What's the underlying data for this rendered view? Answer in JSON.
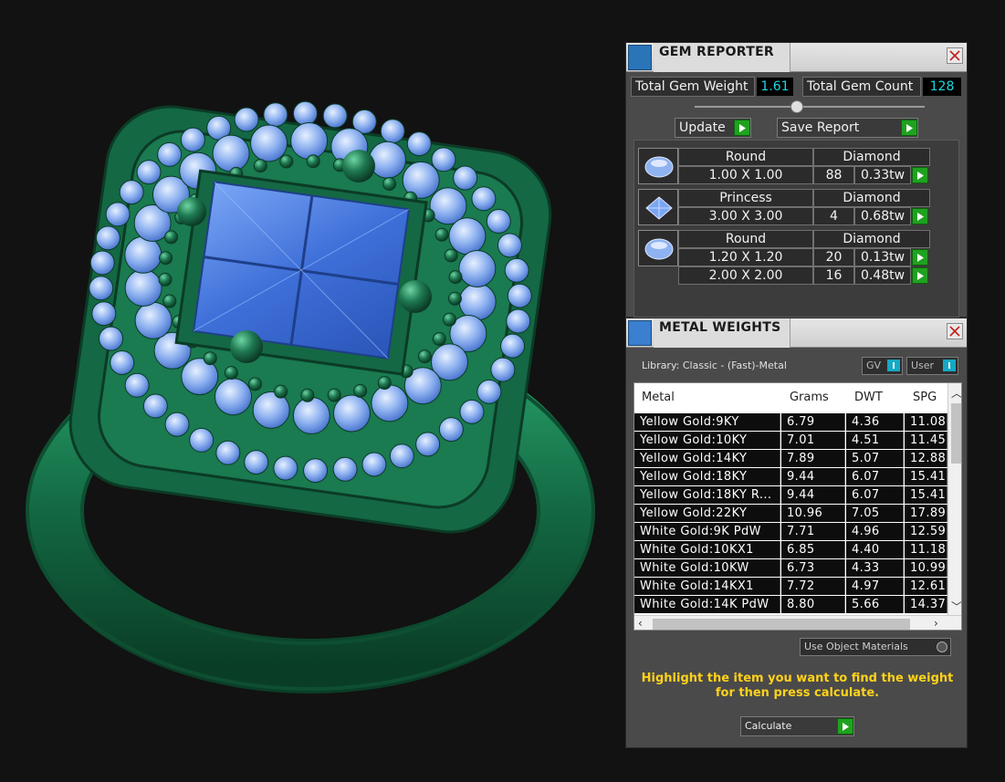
{
  "colors": {
    "ring_metal": "#1f7a52",
    "gem_blue": "#5a8be8",
    "accent_cyan": "#1bd6e0",
    "button_green": "#1fa21f",
    "hint_yellow": "#ffd21a"
  },
  "gem_reporter": {
    "title": "GEM REPORTER",
    "total_weight_label": "Total Gem Weight",
    "total_weight_value": "1.61",
    "total_count_label": "Total Gem Count",
    "total_count_value": "128",
    "update_label": "Update",
    "save_report_label": "Save Report",
    "groups": [
      {
        "shape": "Round",
        "material": "Diamond",
        "icon": "round-gem-icon",
        "rows": [
          {
            "size": "1.00 X 1.00",
            "count": "88",
            "weight": "0.33tw"
          }
        ]
      },
      {
        "shape": "Princess",
        "material": "Diamond",
        "icon": "princess-gem-icon",
        "rows": [
          {
            "size": "3.00 X 3.00",
            "count": "4",
            "weight": "0.68tw"
          }
        ]
      },
      {
        "shape": "Round",
        "material": "Diamond",
        "icon": "round-gem-icon",
        "rows": [
          {
            "size": "1.20 X 1.20",
            "count": "20",
            "weight": "0.13tw"
          },
          {
            "size": "2.00 X 2.00",
            "count": "16",
            "weight": "0.48tw"
          }
        ]
      }
    ]
  },
  "metal_weights": {
    "title": "METAL WEIGHTS",
    "library": "Library: Classic - (Fast)-Metal",
    "toggle_gv": "GV",
    "toggle_user": "User",
    "columns": [
      "Metal",
      "Grams",
      "DWT",
      "SPG"
    ],
    "rows": [
      {
        "metal": "Yellow Gold:9KY",
        "grams": "6.79",
        "dwt": "4.36",
        "spg": "11.08"
      },
      {
        "metal": "Yellow Gold:10KY",
        "grams": "7.01",
        "dwt": "4.51",
        "spg": "11.45"
      },
      {
        "metal": "Yellow Gold:14KY",
        "grams": "7.89",
        "dwt": "5.07",
        "spg": "12.88"
      },
      {
        "metal": "Yellow Gold:18KY",
        "grams": "9.44",
        "dwt": "6.07",
        "spg": "15.41"
      },
      {
        "metal": "Yellow Gold:18KY R...",
        "grams": "9.44",
        "dwt": "6.07",
        "spg": "15.41"
      },
      {
        "metal": "Yellow Gold:22KY",
        "grams": "10.96",
        "dwt": "7.05",
        "spg": "17.89"
      },
      {
        "metal": "White Gold:9K PdW",
        "grams": "7.71",
        "dwt": "4.96",
        "spg": "12.59"
      },
      {
        "metal": "White Gold:10KX1",
        "grams": "6.85",
        "dwt": "4.40",
        "spg": "11.18"
      },
      {
        "metal": "White Gold:10KW",
        "grams": "6.73",
        "dwt": "4.33",
        "spg": "10.99"
      },
      {
        "metal": "White Gold:14KX1",
        "grams": "7.72",
        "dwt": "4.97",
        "spg": "12.61"
      },
      {
        "metal": "White Gold:14K PdW",
        "grams": "8.80",
        "dwt": "5.66",
        "spg": "14.37"
      }
    ],
    "use_object_materials": "Use Object Materials",
    "hint_line1": "Highlight the item you want to find the weight",
    "hint_line2": "for then press calculate.",
    "calculate_label": "Calculate"
  }
}
